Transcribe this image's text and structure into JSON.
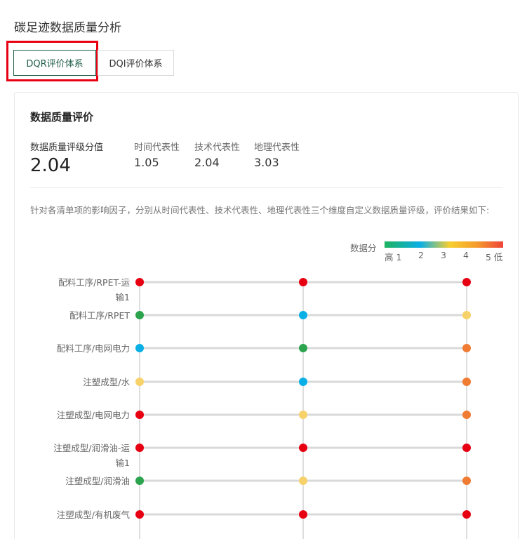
{
  "page": {
    "title": "碳足迹数据质量分析"
  },
  "tabs": [
    {
      "label": "DQR评价体系",
      "active": true
    },
    {
      "label": "DQI评价体系",
      "active": false
    }
  ],
  "card": {
    "title": "数据质量评价",
    "stats": {
      "overall_label": "数据质量评级分值",
      "overall_value": "2.04",
      "time_label": "时间代表性",
      "time_value": "1.05",
      "tech_label": "技术代表性",
      "tech_value": "2.04",
      "geo_label": "地理代表性",
      "geo_value": "3.03"
    },
    "description": "针对各清单项的影响因子，分别从时间代表性、技术代表性、地理代表性三个维度自定义数据质量评级，评价结果如下:"
  },
  "legend": {
    "label": "数据分",
    "ticks": [
      "高 1",
      "2",
      "3",
      "4",
      "5 低"
    ]
  },
  "colors": {
    "accent": "#1f5c4a",
    "highlight_box": "#e60012",
    "score_1": "#2ca44e",
    "score_2": "#0aafe6",
    "score_3": "#f7d26a",
    "score_4": "#f07b33",
    "score_5": "#e60012"
  },
  "chart_data": {
    "type": "dot-matrix",
    "rows": [
      {
        "label_lines": [
          "配料工序/RPET-运",
          "输1"
        ],
        "scores": [
          5,
          5,
          5
        ]
      },
      {
        "label_lines": [
          "配料工序/RPET"
        ],
        "scores": [
          1,
          2,
          3
        ]
      },
      {
        "label_lines": [
          "配料工序/电网电力"
        ],
        "scores": [
          2,
          1,
          4
        ]
      },
      {
        "label_lines": [
          "注塑成型/水"
        ],
        "scores": [
          3,
          2,
          4
        ]
      },
      {
        "label_lines": [
          "注塑成型/电网电力"
        ],
        "scores": [
          5,
          3,
          4
        ]
      },
      {
        "label_lines": [
          "注塑成型/润滑油-运",
          "输1"
        ],
        "scores": [
          5,
          5,
          5
        ]
      },
      {
        "label_lines": [
          "注塑成型/润滑油"
        ],
        "scores": [
          1,
          3,
          4
        ]
      },
      {
        "label_lines": [
          "注塑成型/有机废气"
        ],
        "scores": [
          5,
          5,
          5
        ]
      }
    ]
  }
}
